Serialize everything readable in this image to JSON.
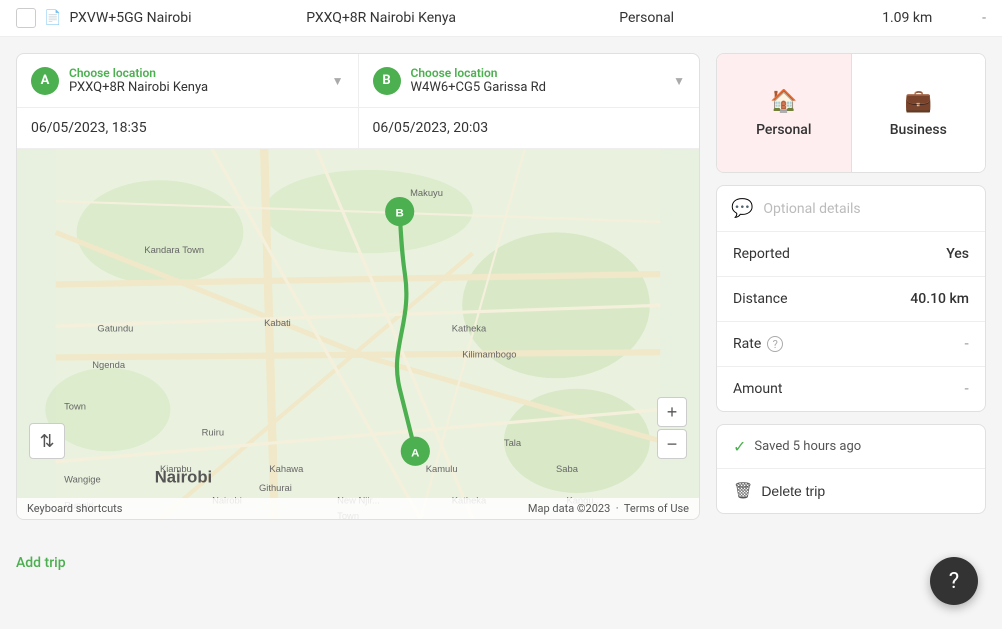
{
  "tableRow": {
    "name": "PXVW+5GG Nairobi",
    "destination": "PXXQ+8R Nairobi Kenya",
    "type": "Personal",
    "distance": "1.09 km",
    "extra": "-"
  },
  "locationA": {
    "badge": "A",
    "label": "Choose location",
    "value": "PXXQ+8R Nairobi Kenya"
  },
  "locationB": {
    "badge": "B",
    "label": "Choose location",
    "value": "W4W6+CG5 Garissa Rd"
  },
  "dateStart": "06/05/2023, 18:35",
  "dateEnd": "06/05/2023, 20:03",
  "tripType": {
    "personal": "Personal",
    "business": "Business"
  },
  "optionalDetails": {
    "placeholder": "Optional details"
  },
  "details": {
    "reportedLabel": "Reported",
    "reportedValue": "Yes",
    "distanceLabel": "Distance",
    "distanceValue": "40.10 km",
    "rateLabel": "Rate",
    "rateValue": "-",
    "amountLabel": "Amount",
    "amountValue": "-"
  },
  "savedStatus": "Saved 5 hours ago",
  "deleteBtn": "Delete trip",
  "addTrip": "Add trip",
  "helpIcon": "?",
  "map": {
    "keyboardShortcuts": "Keyboard shortcuts",
    "mapData": "Map data ©2023",
    "termsOfUse": "Terms of Use"
  }
}
